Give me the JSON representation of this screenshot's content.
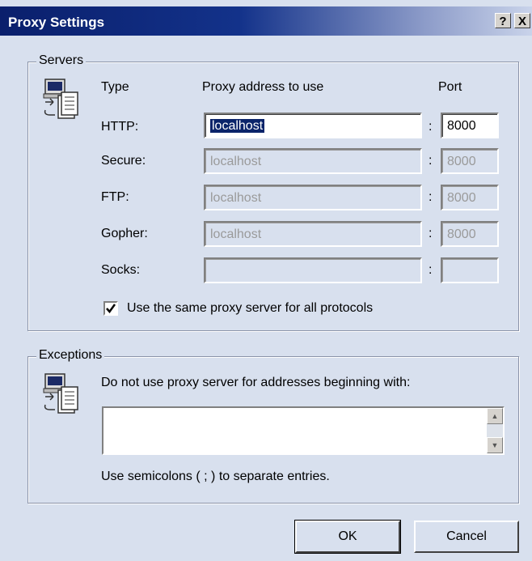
{
  "window": {
    "title": "Proxy Settings",
    "help_button": "?",
    "close_button": "X"
  },
  "servers": {
    "group_label": "Servers",
    "col_type": "Type",
    "col_address": "Proxy address to use",
    "col_port": "Port",
    "rows": [
      {
        "label": "HTTP:",
        "address": "localhost",
        "port": "8000",
        "enabled": true
      },
      {
        "label": "Secure:",
        "address": "localhost",
        "port": "8000",
        "enabled": false
      },
      {
        "label": "FTP:",
        "address": "localhost",
        "port": "8000",
        "enabled": false
      },
      {
        "label": "Gopher:",
        "address": "localhost",
        "port": "8000",
        "enabled": false
      },
      {
        "label": "Socks:",
        "address": "",
        "port": "",
        "enabled": false
      }
    ],
    "colon": ":",
    "same_proxy_label": "Use the same proxy server for all protocols",
    "same_proxy_checked": true
  },
  "exceptions": {
    "group_label": "Exceptions",
    "instruction": "Do not use proxy server for addresses beginning with:",
    "value": "",
    "hint": "Use semicolons ( ; ) to separate entries."
  },
  "buttons": {
    "ok": "OK",
    "cancel": "Cancel"
  }
}
